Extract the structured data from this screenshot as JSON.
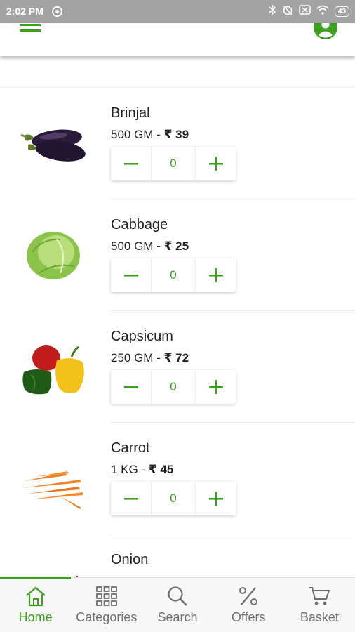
{
  "status_bar": {
    "time": "2:02 PM",
    "battery": "43"
  },
  "colors": {
    "accent": "#3c9f1f",
    "inactive": "#6f6f6f",
    "status_bar": "#a3a3a3"
  },
  "app_bar": {
    "menu_icon": "hamburger-menu-icon",
    "profile_icon": "account-circle-icon"
  },
  "products": [
    {
      "name": "Brinjal",
      "unit": "500 GM",
      "separator": " - ",
      "price": "₹ 39",
      "quantity": "0",
      "image": "brinjal-image"
    },
    {
      "name": "Cabbage",
      "unit": "500 GM",
      "separator": " - ",
      "price": "₹ 25",
      "quantity": "0",
      "image": "cabbage-image"
    },
    {
      "name": "Capsicum",
      "unit": "250 GM",
      "separator": " - ",
      "price": "₹ 72",
      "quantity": "0",
      "image": "capsicum-image"
    },
    {
      "name": "Carrot",
      "unit": "1 KG",
      "separator": " - ",
      "price": "₹ 45",
      "quantity": "0",
      "image": "carrot-image"
    },
    {
      "name": "Onion",
      "image": "onion-image"
    }
  ],
  "stepper": {
    "decrement_icon": "minus-icon",
    "increment_icon": "plus-icon"
  },
  "bottom_nav": [
    {
      "label": "Home",
      "icon": "home-icon",
      "active": true
    },
    {
      "label": "Categories",
      "icon": "grid-icon",
      "active": false
    },
    {
      "label": "Search",
      "icon": "search-icon",
      "active": false
    },
    {
      "label": "Offers",
      "icon": "percent-icon",
      "active": false
    },
    {
      "label": "Basket",
      "icon": "basket-icon",
      "active": false
    }
  ]
}
